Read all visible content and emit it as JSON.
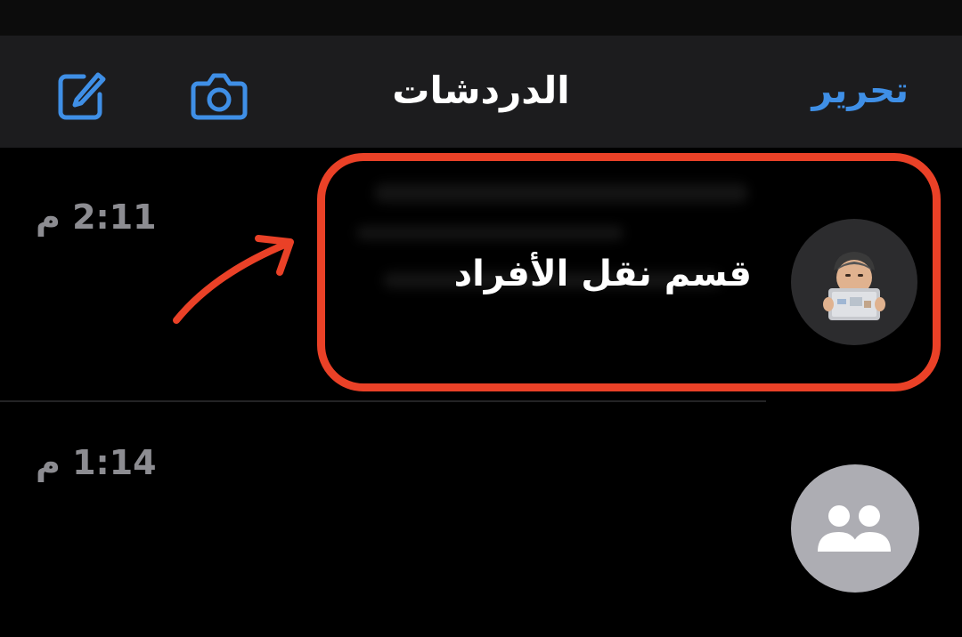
{
  "header": {
    "title": "الدردشات",
    "edit_label": "تحرير",
    "camera_icon": "camera-icon",
    "compose_icon": "compose-icon"
  },
  "chats": [
    {
      "name": "قسم  نقل  الأفراد",
      "time": "2:11 م",
      "avatar": "memoji-avatar",
      "highlighted": true
    },
    {
      "name": "",
      "time": "1:14 م",
      "avatar": "group-icon"
    }
  ],
  "colors": {
    "accent": "#3f8fe6",
    "annotation": "#ea4127",
    "nav_background": "#1c1c1e",
    "time_text": "#8c8c91"
  }
}
